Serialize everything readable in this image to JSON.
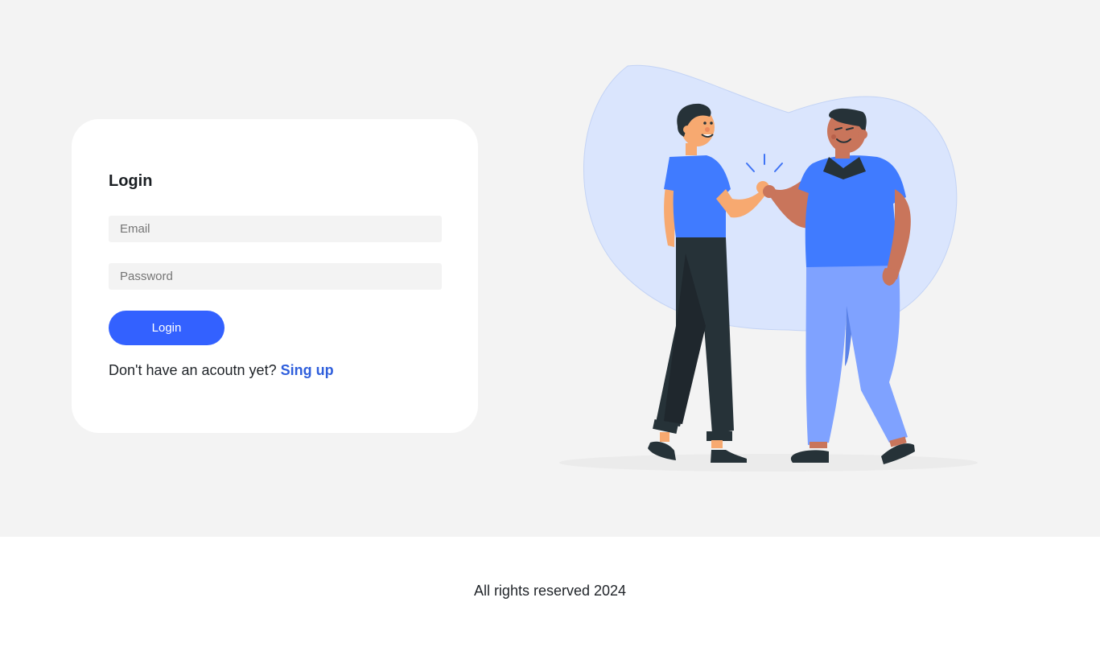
{
  "login": {
    "title": "Login",
    "email_placeholder": "Email",
    "email_value": "",
    "password_placeholder": "Password",
    "password_value": "",
    "button_label": "Login",
    "signup_prompt": "Don't have an acoutn yet?",
    "signup_link": "Sing up"
  },
  "illustration": {
    "icon": "two-people-fist-bump-illustration"
  },
  "footer": {
    "text": "All rights reserved 2024"
  },
  "colors": {
    "accent": "#3361ff",
    "link": "#2f5fdc",
    "background": "#f3f3f3",
    "blob": "#dae5fd"
  }
}
